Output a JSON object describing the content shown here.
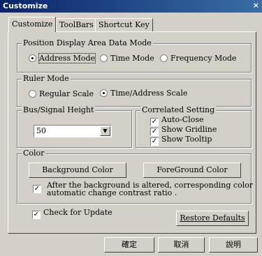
{
  "window": {
    "title": "Customize",
    "close": "×"
  },
  "tabs": [
    "Customize",
    "ToolBars",
    "Shortcut Key"
  ],
  "position_group": {
    "legend": "Position Display Area Data Mode",
    "options": [
      "Address Mode",
      "Time Mode",
      "Frequency Mode"
    ],
    "selected": "Address Mode"
  },
  "ruler_group": {
    "legend": "Ruler Mode",
    "options": [
      "Regular Scale",
      "Time/Address Scale"
    ],
    "selected": "Time/Address Scale"
  },
  "bus_group": {
    "legend": "Bus/Signal Height",
    "value": "50"
  },
  "correlated_group": {
    "legend": "Correlated Setting",
    "items": [
      {
        "label": "Auto-Close",
        "checked": true
      },
      {
        "label": "Show Gridline",
        "checked": true
      },
      {
        "label": "Show Tooltip",
        "checked": true
      }
    ]
  },
  "color_group": {
    "legend": "Color",
    "background_button": "Background Color",
    "foreground_button": "ForeGround Color",
    "auto_contrast_line1": "After the background is altered, corresponding color",
    "auto_contrast_line2": "automatic change contrast ratio .",
    "auto_contrast_checked": true
  },
  "check_update": {
    "label": "Check for Update",
    "checked": true
  },
  "restore_defaults": "Restore Defaults",
  "footer": {
    "ok": "確定",
    "cancel": "取消",
    "help": "說明"
  },
  "check_mark": "✓",
  "colors": {
    "face": "#d4d0c8",
    "title_start": "#0a246a",
    "title_end": "#3a6ea5"
  }
}
